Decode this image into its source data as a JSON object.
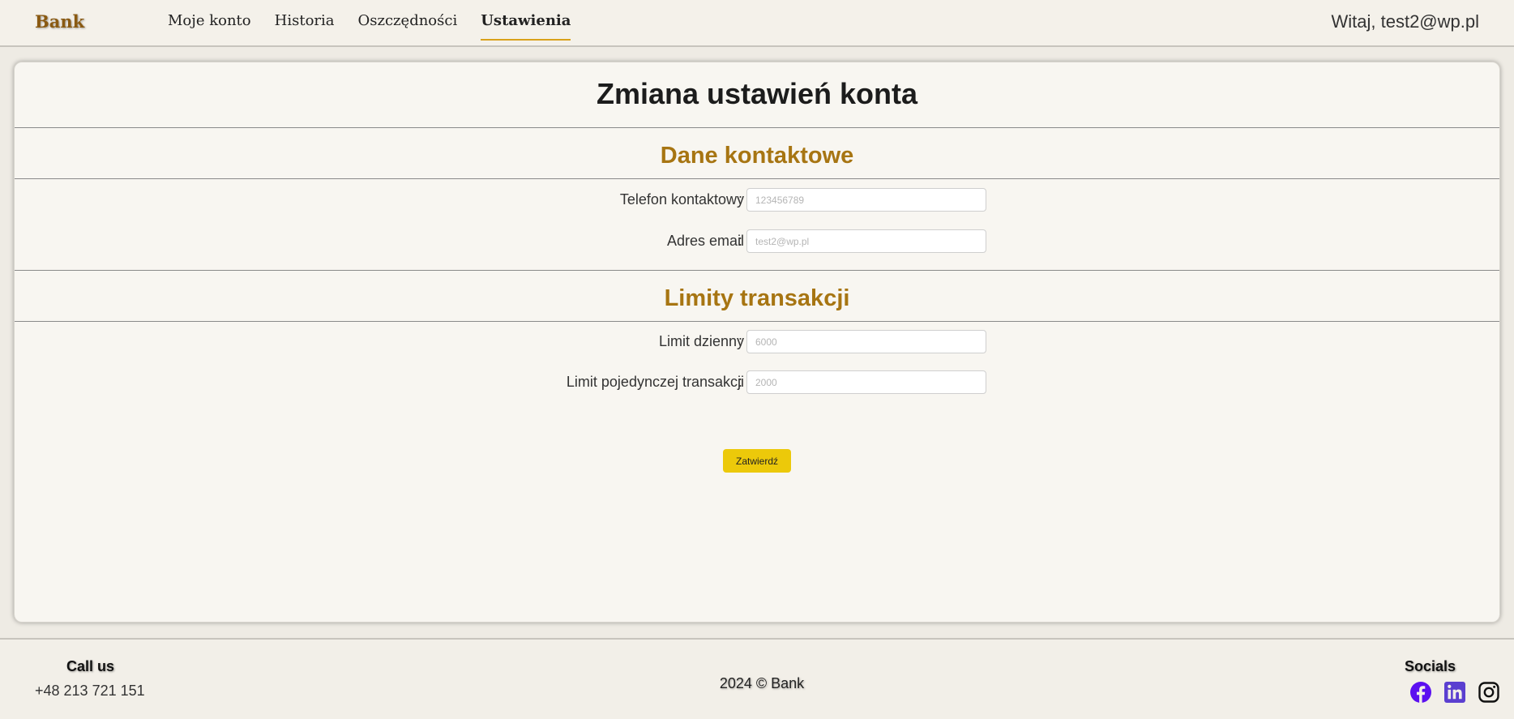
{
  "navbar": {
    "brand": "Bank",
    "links": [
      {
        "label": "Moje konto"
      },
      {
        "label": "Historia"
      },
      {
        "label": "Oszczędności"
      },
      {
        "label": "Ustawienia",
        "active": true
      }
    ],
    "greeting": "Witaj, test2@wp.pl"
  },
  "main": {
    "title": "Zmiana ustawień konta",
    "contact": {
      "title": "Dane kontaktowe",
      "phone_label": "Telefon kontaktowy",
      "phone_placeholder": "123456789",
      "email_label": "Adres email",
      "email_placeholder": "test2@wp.pl"
    },
    "limits": {
      "title": "Limity transakcji",
      "daily_label": "Limit dzienny",
      "daily_placeholder": "6000",
      "single_label": "Limit pojedynczej transakcji",
      "single_placeholder": "2000"
    },
    "colon": ":",
    "submit_label": "Zatwierdź"
  },
  "footer": {
    "call_title": "Call us",
    "phone": "+48 213 721 151",
    "copyright": "2024 © Bank",
    "socials_title": "Socials",
    "icons": [
      "facebook-icon",
      "linkedin-icon",
      "instagram-icon"
    ]
  },
  "colors": {
    "accent": "#d9a11a",
    "section_title": "#a77512",
    "button": "#ecc90a",
    "facebook": "#5b10f0",
    "linkedin": "#5b3fd0"
  }
}
